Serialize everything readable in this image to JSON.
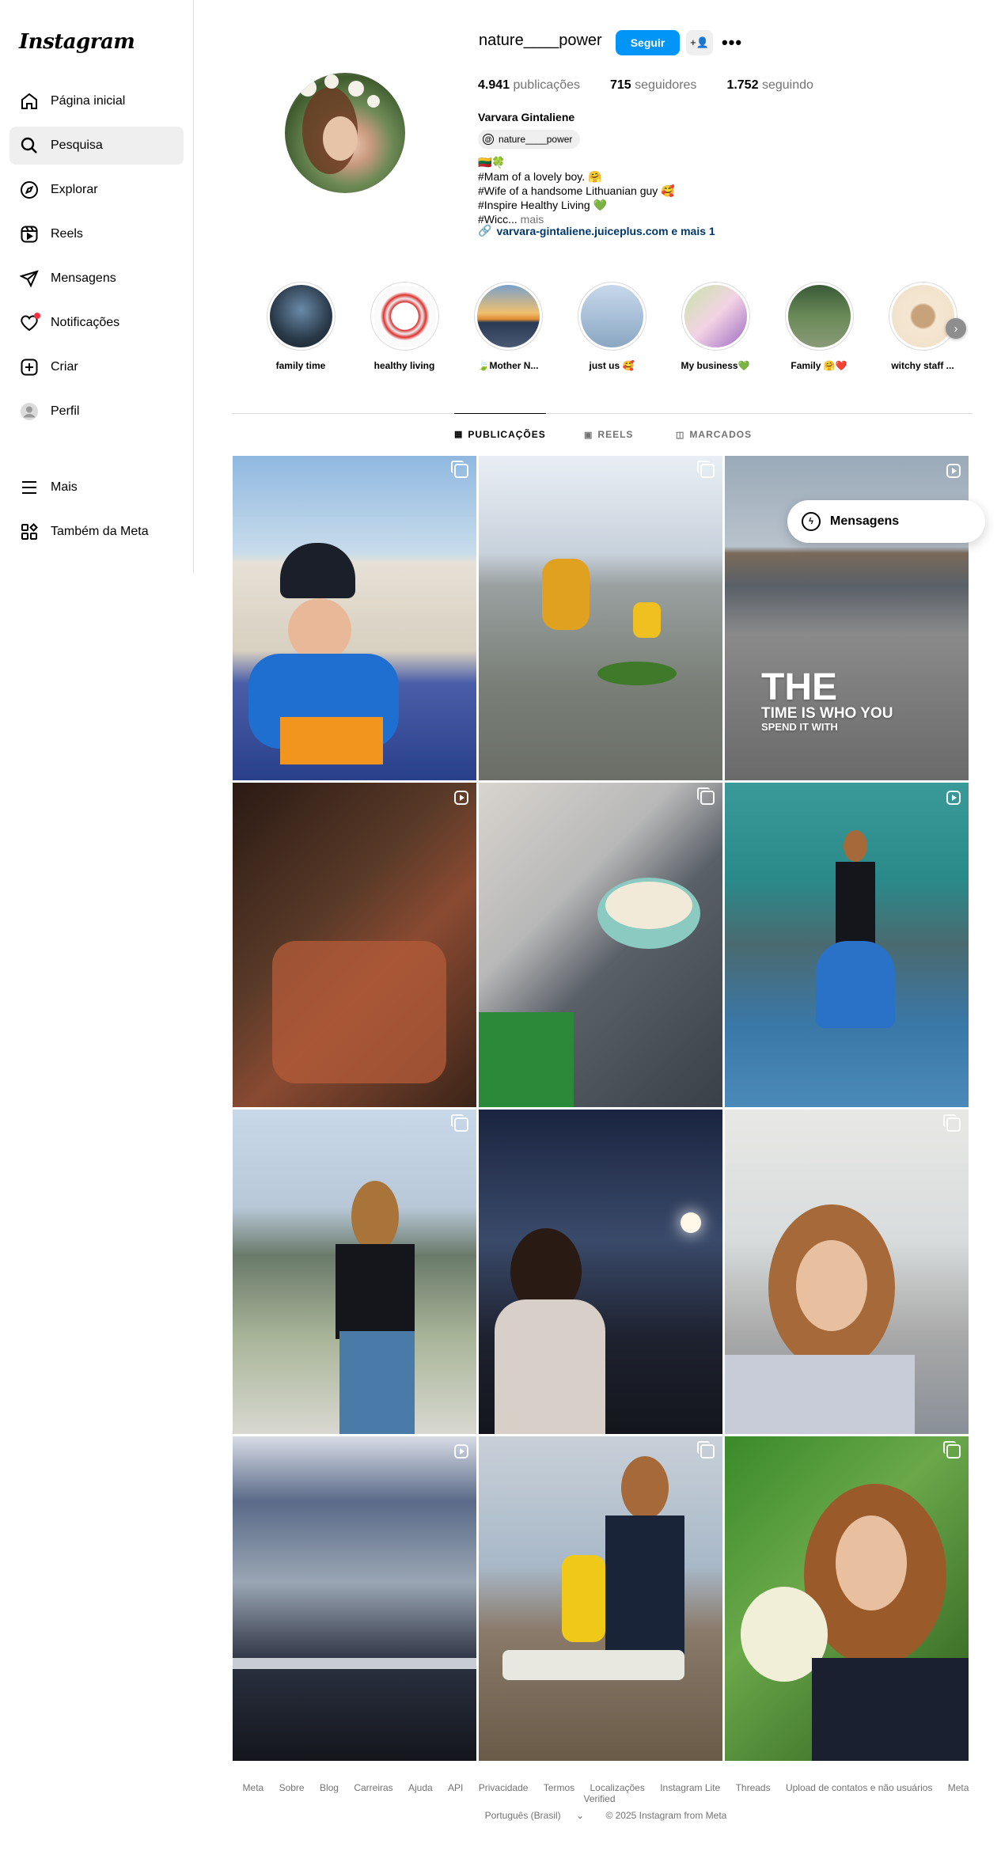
{
  "app": {
    "logo": "Instagram"
  },
  "sidebar": {
    "items": [
      {
        "label": "Página inicial",
        "icon": "home-icon"
      },
      {
        "label": "Pesquisa",
        "icon": "search-icon"
      },
      {
        "label": "Explorar",
        "icon": "compass-icon"
      },
      {
        "label": "Reels",
        "icon": "reels-icon"
      },
      {
        "label": "Mensagens",
        "icon": "send-icon"
      },
      {
        "label": "Notificações",
        "icon": "heart-icon"
      },
      {
        "label": "Criar",
        "icon": "plus-square-icon"
      },
      {
        "label": "Perfil",
        "icon": "avatar-icon"
      },
      {
        "label": "Mais",
        "icon": "menu-icon"
      },
      {
        "label": "Também da Meta",
        "icon": "meta-apps-icon"
      }
    ]
  },
  "profile": {
    "username": "nature____power",
    "follow_label": "Seguir",
    "add_user_icon": "+👤",
    "more_icon": "•••",
    "stats": {
      "posts_count": "4.941",
      "posts_label": "publicações",
      "followers_count": "715",
      "followers_label": "seguidores",
      "following_count": "1.752",
      "following_label": "seguindo"
    },
    "full_name": "Varvara Gintaliene",
    "threads_handle": "nature____power",
    "bio": {
      "line1": "🇱🇹🍀",
      "line2": "#Mam of a lovely boy. 🤗",
      "line3": "#Wife of a handsome Lithuanian guy 🥰",
      "line4": "#Inspire Healthy Living 💚",
      "line5": "#Wicc...",
      "more": "mais"
    },
    "link": "varvara-gintaliene.juiceplus.com e mais 1"
  },
  "highlights": [
    {
      "label": "family time"
    },
    {
      "label": "healthy living"
    },
    {
      "label": "🍃Mother N..."
    },
    {
      "label": "just us 🥰"
    },
    {
      "label": "My business💚"
    },
    {
      "label": "Family 🤗❤️"
    },
    {
      "label": "witchy staff ..."
    }
  ],
  "tabs": [
    {
      "label": "PUBLICAÇÕES",
      "icon": "grid-icon"
    },
    {
      "label": "REELS",
      "icon": "reels-icon"
    },
    {
      "label": "MARCADOS",
      "icon": "tagged-icon"
    }
  ],
  "posts": {
    "overlay": {
      "big": "THE",
      "mid": "TIME IS WHO YOU",
      "small": "SPEND IT WITH"
    }
  },
  "messages_button": {
    "label": "Mensagens"
  },
  "footer": {
    "links": [
      "Meta",
      "Sobre",
      "Blog",
      "Carreiras",
      "Ajuda",
      "API",
      "Privacidade",
      "Termos",
      "Localizações",
      "Instagram Lite",
      "Threads",
      "Upload de contatos e não usuários",
      "Meta Verified"
    ],
    "language": "Português (Brasil)",
    "copyright": "© 2025 Instagram from Meta"
  },
  "colors": {
    "accent": "#0095f6",
    "link": "#00376b",
    "secondary_text": "#737373",
    "notification_dot": "#ff3040"
  }
}
